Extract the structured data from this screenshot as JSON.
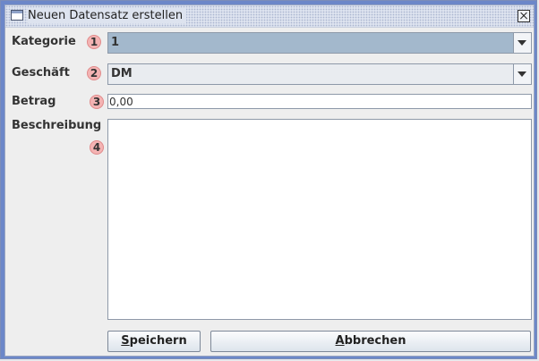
{
  "window": {
    "title": "Neuen Datensatz erstellen"
  },
  "fields": {
    "kategorie": {
      "label": "Kategorie",
      "marker": "1",
      "value": "1"
    },
    "geschaeft": {
      "label": "Geschäft",
      "marker": "2",
      "value": "DM"
    },
    "betrag": {
      "label": "Betrag",
      "marker": "3",
      "value": "0,00"
    },
    "beschreibung": {
      "label": "Beschreibung",
      "marker": "4",
      "value": ""
    }
  },
  "buttons": {
    "save": {
      "mnemonic": "S",
      "rest": "peichern"
    },
    "cancel": {
      "mnemonic": "A",
      "rest": "bbrechen"
    }
  },
  "colors": {
    "window_border": "#6c87c9",
    "selected_combo": "#a3b8cc",
    "marker_badge": "#f4b3b3"
  },
  "icons": {
    "window": "window-icon",
    "close": "close-icon",
    "dropdown": "chevron-down-icon"
  }
}
